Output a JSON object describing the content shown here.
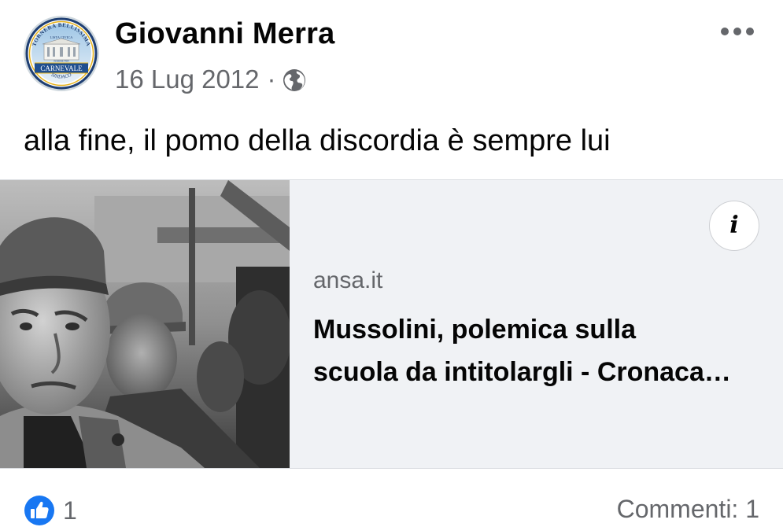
{
  "post": {
    "author": {
      "name": "Giovanni Merra",
      "avatar": {
        "icon": "campaign-logo-icon",
        "arc_text": "TORNERA BELLISSIMA",
        "subtitle": "LISTA CIVICA",
        "small_text": "INSIEME PER",
        "banner": "CARNEVALE",
        "bottom_text": "SINDACO"
      }
    },
    "date": "16 Lug 2012",
    "separator": "·",
    "visibility_icon": "globe-icon",
    "more_icon": "more-options-icon",
    "text": "alla fine, il pomo della discordia è sempre lui",
    "link_preview": {
      "thumbnail": "photo-thumbnail",
      "info_label": "i",
      "domain": "ansa.it",
      "title_lines": [
        "Mussolini, polemica sulla",
        "scuola da intitolargli - Cronaca…"
      ]
    },
    "reactions": {
      "icon": "like-icon",
      "count": "1"
    },
    "comments_label": "Commenti: 1"
  },
  "colors": {
    "like_blue": "#1877f2",
    "secondary_text": "#65676b",
    "card_background": "#f0f2f5"
  }
}
